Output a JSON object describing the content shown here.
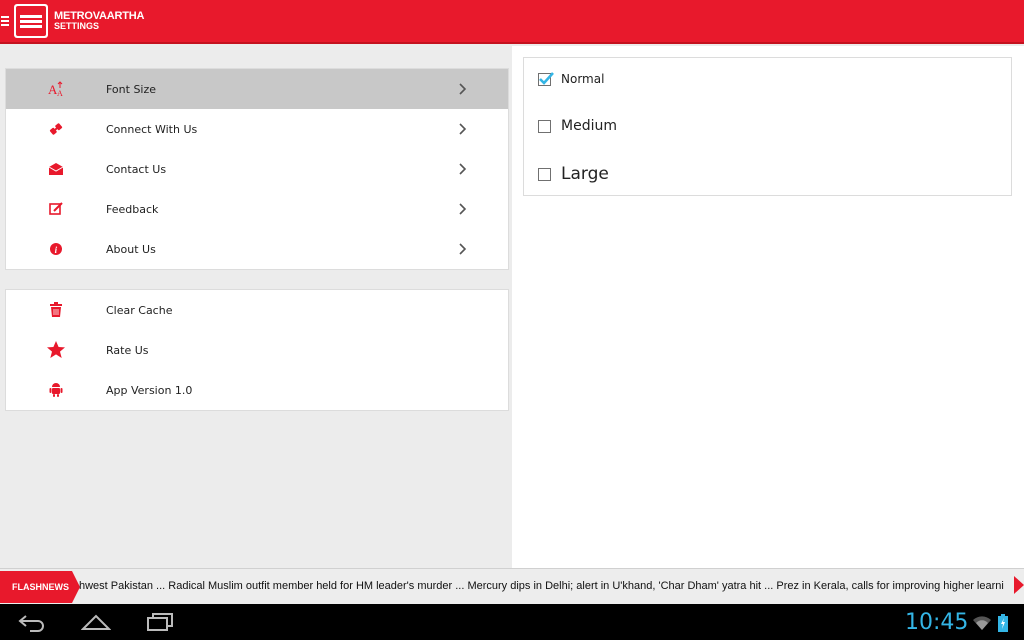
{
  "header": {
    "app_title": "METROVAARTHA",
    "subtitle": "SETTINGS"
  },
  "menu_group_1": [
    {
      "label": "Font Size",
      "icon": "font-size-icon",
      "selected": true
    },
    {
      "label": "Connect With Us",
      "icon": "connect-icon"
    },
    {
      "label": "Contact Us",
      "icon": "envelope-icon"
    },
    {
      "label": "Feedback",
      "icon": "edit-icon"
    },
    {
      "label": "About Us",
      "icon": "info-icon"
    }
  ],
  "menu_group_2": [
    {
      "label": "Clear Cache",
      "icon": "trash-icon"
    },
    {
      "label": "Rate Us",
      "icon": "star-icon"
    },
    {
      "label": "App Version 1.0",
      "icon": "android-icon"
    }
  ],
  "font_options": [
    {
      "label": "Normal",
      "checked": true
    },
    {
      "label": "Medium",
      "checked": false
    },
    {
      "label": "Large",
      "checked": false
    }
  ],
  "ticker": {
    "tag": "FLASHNEWS",
    "text": "hwest Pakistan ... Radical Muslim outfit member held for HM leader's murder ... Mercury dips in Delhi; alert in U'khand, 'Char Dham' yatra hit ... Prez in Kerala, calls for improving higher learni"
  },
  "status": {
    "time": "10:45"
  },
  "colors": {
    "accent": "#e8192c",
    "checkmark": "#34b5e5",
    "clock": "#34b5e5"
  }
}
